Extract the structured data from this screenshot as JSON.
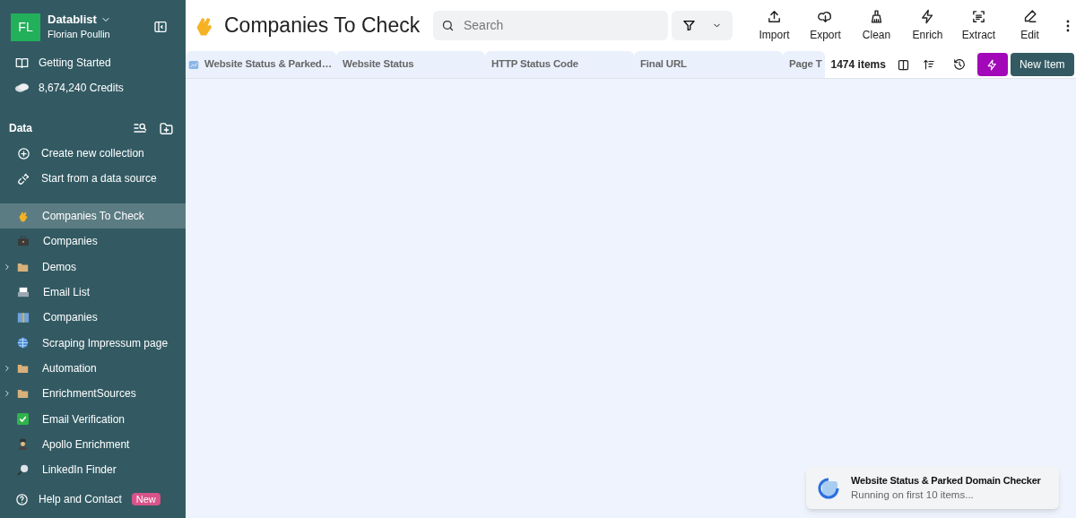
{
  "sidebar": {
    "avatar": "FL",
    "workspace": "Datablist",
    "user": "Florian Poullin",
    "links": [
      {
        "label": "Getting Started"
      },
      {
        "label": "8,674,240 Credits"
      }
    ],
    "section": "Data",
    "actions": [
      {
        "label": "Create new collection"
      },
      {
        "label": "Start from a data source"
      }
    ],
    "collections": [
      {
        "label": "Companies To Check",
        "kind": "collection",
        "selected": true
      },
      {
        "label": "Companies",
        "kind": "collection",
        "selected": false
      },
      {
        "label": "Demos",
        "kind": "folder",
        "selected": false
      },
      {
        "label": "Email List",
        "kind": "collection",
        "selected": false
      },
      {
        "label": "Companies",
        "kind": "collection",
        "selected": false
      },
      {
        "label": "Scraping Impressum page",
        "kind": "collection",
        "selected": false
      },
      {
        "label": "Automation",
        "kind": "folder",
        "selected": false
      },
      {
        "label": "EnrichmentSources",
        "kind": "folder",
        "selected": false
      },
      {
        "label": "Email Verification",
        "kind": "collection",
        "selected": false
      },
      {
        "label": "Apollo Enrichment",
        "kind": "collection",
        "selected": false
      },
      {
        "label": "LinkedIn Finder",
        "kind": "collection",
        "selected": false
      }
    ],
    "help": {
      "label": "Help and Contact",
      "badge": "New"
    }
  },
  "header": {
    "title": "Companies To Check",
    "search": {
      "placeholder": "Search"
    },
    "toolbar": [
      {
        "label": "Import"
      },
      {
        "label": "Export"
      },
      {
        "label": "Clean"
      },
      {
        "label": "Enrich"
      },
      {
        "label": "Extract"
      },
      {
        "label": "Edit"
      }
    ]
  },
  "table": {
    "columns": [
      "Website Status & Parked…",
      "Website Status",
      "HTTP Status Code",
      "Final URL",
      "Page T"
    ],
    "count": "1474 items",
    "new_button": "New Item"
  },
  "toast": {
    "title": "Website Status & Parked Domain Checker",
    "message": "Running on first 10 items..."
  }
}
